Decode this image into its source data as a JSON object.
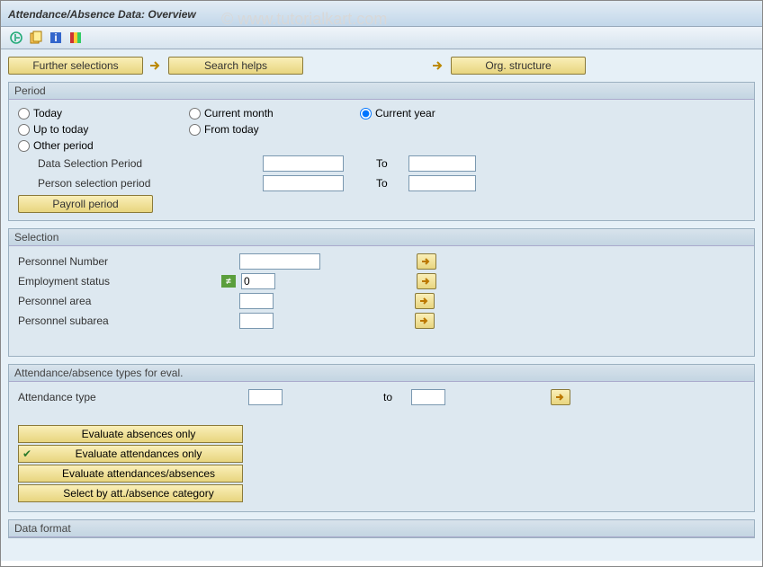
{
  "title": "Attendance/Absence Data: Overview",
  "watermark": "© www.tutorialkart.com",
  "toolbar": {
    "execute_icon": "execute",
    "variant_icon": "variant",
    "info_icon": "info",
    "layout_icon": "layout"
  },
  "buttons": {
    "further_selections": "Further selections",
    "search_helps": "Search helps",
    "org_structure": "Org. structure",
    "payroll_period": "Payroll period"
  },
  "period": {
    "group_title": "Period",
    "today": "Today",
    "current_month": "Current month",
    "current_year": "Current year",
    "up_to_today": "Up to today",
    "from_today": "From today",
    "other_period": "Other period",
    "data_selection_period": "Data Selection Period",
    "person_selection_period": "Person selection period",
    "to": "To",
    "selected": "current_year",
    "data_from": "",
    "data_to": "",
    "person_from": "",
    "person_to": ""
  },
  "selection": {
    "group_title": "Selection",
    "personnel_number": "Personnel Number",
    "employment_status": "Employment status",
    "personnel_area": "Personnel area",
    "personnel_subarea": "Personnel subarea",
    "personnel_number_val": "",
    "employment_status_val": "0",
    "personnel_area_val": "",
    "personnel_subarea_val": ""
  },
  "att_types": {
    "group_title": "Attendance/absence types for eval.",
    "attendance_type": "Attendance type",
    "to": "to",
    "from_val": "",
    "to_val": "",
    "eval_absences_only": "Evaluate absences only",
    "eval_attendances_only": "Evaluate attendances only",
    "eval_both": "Evaluate attendances/absences",
    "select_by_category": "Select by att./absence category"
  },
  "data_format": {
    "group_title": "Data format"
  }
}
